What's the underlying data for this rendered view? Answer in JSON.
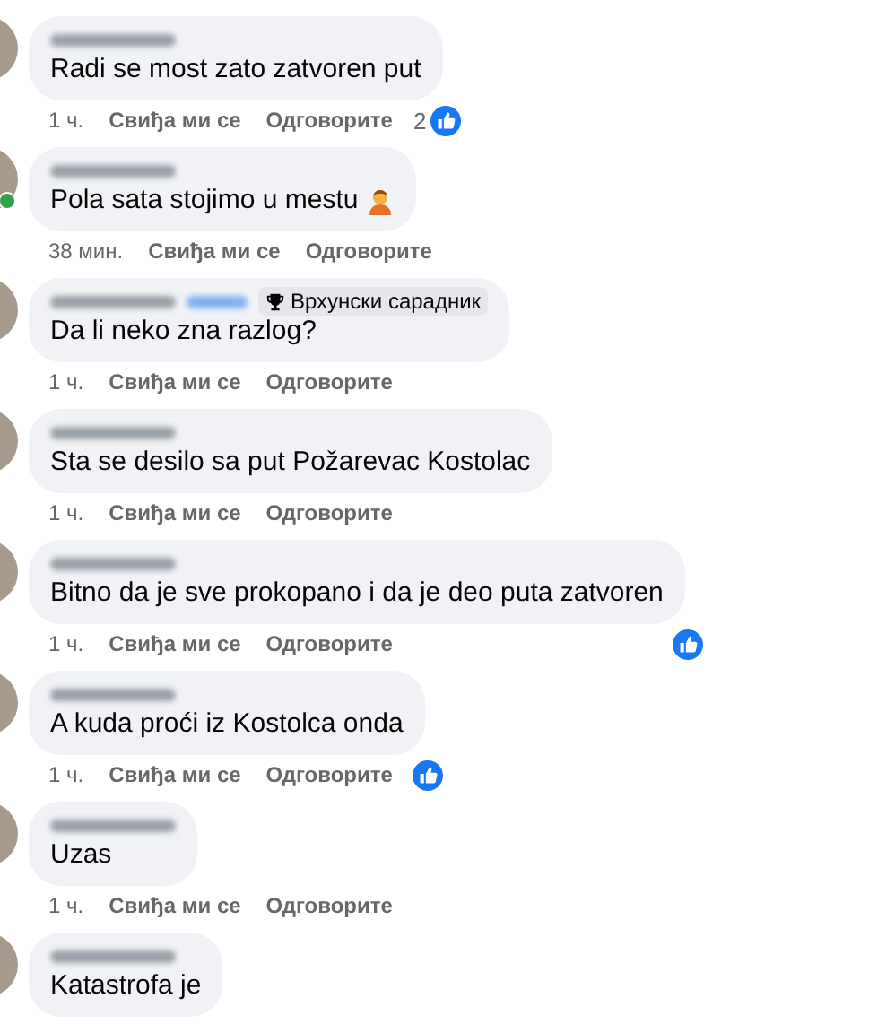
{
  "comments": [
    {
      "text": "Radi se most zato zatvoren put",
      "time": "1 ч.",
      "like": "Свиђа ми се",
      "reply": "Одговорите",
      "online": false,
      "emoji": false,
      "liked": true,
      "like_count": "2"
    },
    {
      "text": "Pola sata stojimo u mestu",
      "time": "38 мин.",
      "like": "Свиђа ми се",
      "reply": "Одговорите",
      "online": true,
      "emoji": true,
      "liked": false
    },
    {
      "text": "Da li neko zna razlog?",
      "time": "1 ч.",
      "like": "Свиђа ми се",
      "reply": "Одговорите",
      "online": false,
      "emoji": false,
      "liked": false,
      "badge": "Врхунски сарадник"
    },
    {
      "text": "Sta se desilo sa put Požarevac Kostolac",
      "time": "1 ч.",
      "like": "Свиђа ми се",
      "reply": "Одговорите",
      "online": false,
      "emoji": false,
      "liked": false
    },
    {
      "text": "Bitno da je sve prokopano i da je deo puta zatvoren",
      "time": "1 ч.",
      "like": "Свиђа ми се",
      "reply": "Одговорите",
      "online": false,
      "emoji": false,
      "liked": true
    },
    {
      "text": "A kuda proći iz Kostolca onda",
      "time": "1 ч.",
      "like": "Свиђа ми се",
      "reply": "Одговорите",
      "online": false,
      "emoji": false,
      "liked": true
    },
    {
      "text": "Uzas",
      "time": "1 ч.",
      "like": "Свиђа ми се",
      "reply": "Одговорите",
      "online": false,
      "emoji": false,
      "liked": false
    },
    {
      "text": "Katastrofa je",
      "online": false,
      "emoji": false
    }
  ]
}
